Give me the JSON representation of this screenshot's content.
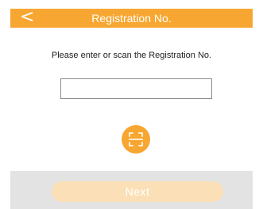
{
  "header": {
    "back_icon": "<",
    "title": "Registration No."
  },
  "instruction": "Please enter or scan the Registration No.",
  "registration_input": {
    "value": "",
    "placeholder": ""
  },
  "scan_button": {
    "icon": "scan-icon"
  },
  "footer": {
    "next_label": "Next",
    "next_enabled": false
  },
  "colors": {
    "accent": "#f7a731",
    "next_disabled_bg": "#fbe0b7",
    "footer_bg": "#e3e3e3"
  }
}
